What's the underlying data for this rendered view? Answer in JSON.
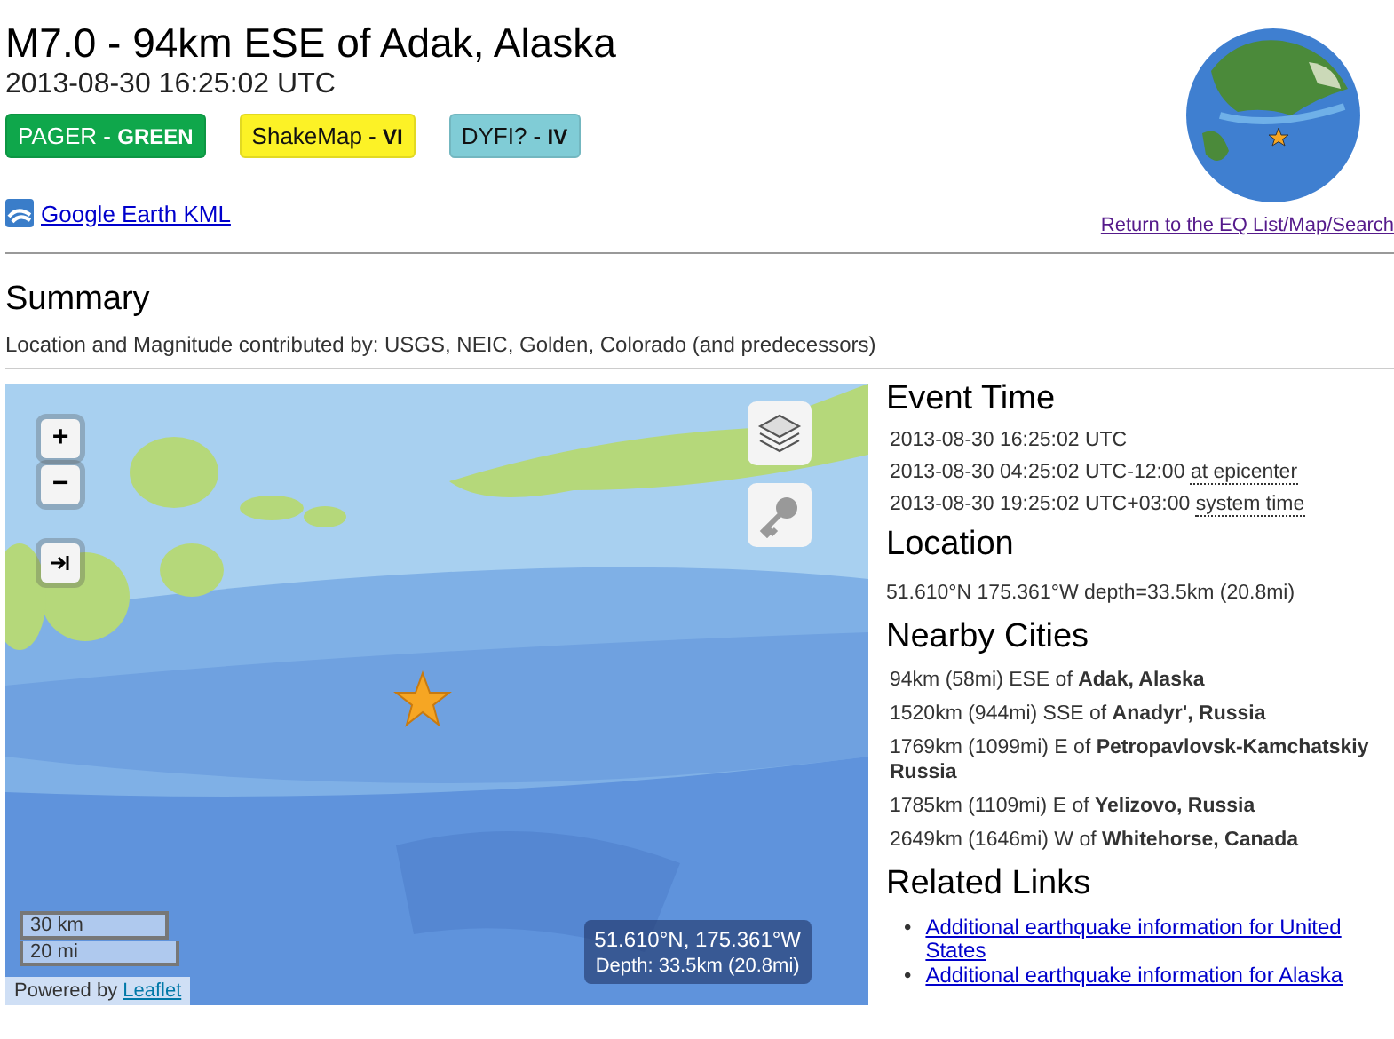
{
  "title": "M7.0 - 94km ESE of Adak, Alaska",
  "subtitle": "2013-08-30 16:25:02 UTC",
  "badges": [
    {
      "text": "PAGER - **GREEN**",
      "color": "#0fa74b"
    },
    {
      "text": "ShakeMap - **VI**",
      "color": "#fcf226"
    },
    {
      "text": "DYFI? - **IV**",
      "color": "#80ccd6"
    }
  ],
  "kml_link": "Google Earth KML",
  "return_link": "Return to the EQ List/Map/Search",
  "summary": {
    "heading": "Summary",
    "contributors": "Location and Magnitude contributed by: USGS, NEIC, Golden, Colorado (and predecessors)"
  },
  "map": {
    "zoom_in": "+",
    "zoom_out": "−",
    "scale": [
      "30 km",
      "20 mi"
    ],
    "attribution": "Powered by",
    "attribution_link": "Leaflet",
    "info": [
      "51.610°N, 175.361°W",
      "Depth: 33.5km (20.8mi)"
    ]
  },
  "event_time": {
    "heading": "Event Time",
    "rows": [
      {
        "time": "2013-08-30 16:25:02 UTC"
      },
      {
        "time": "2013-08-30 04:25:02 UTC-12:00",
        "note": "at epicenter"
      },
      {
        "time": "2013-08-30 19:25:02 UTC+03:00",
        "note": "system time"
      }
    ]
  },
  "location": {
    "heading": "Location",
    "text": "51.610°N 175.361°W depth=33.5km (20.8mi)"
  },
  "nearby_cities": {
    "heading": "Nearby Cities",
    "items": [
      "94km (58mi) ESE of **Adak, Alaska**",
      "1520km (944mi) SSE of **Anadyr', Russia**",
      "1769km (1099mi) E of **Petropavlovsk-Kamchatskiy** **Russia**",
      "1785km (1109mi) E of **Yelizovo, Russia**",
      "2649km (1646mi) W of **Whitehorse, Canada**"
    ]
  },
  "related_links": {
    "heading": "Related Links",
    "items": [
      {
        "marker": "•",
        "text": "Additional earthquake information for United States"
      },
      {
        "marker": "•",
        "text": "Additional earthquake information for Alaska"
      }
    ]
  }
}
